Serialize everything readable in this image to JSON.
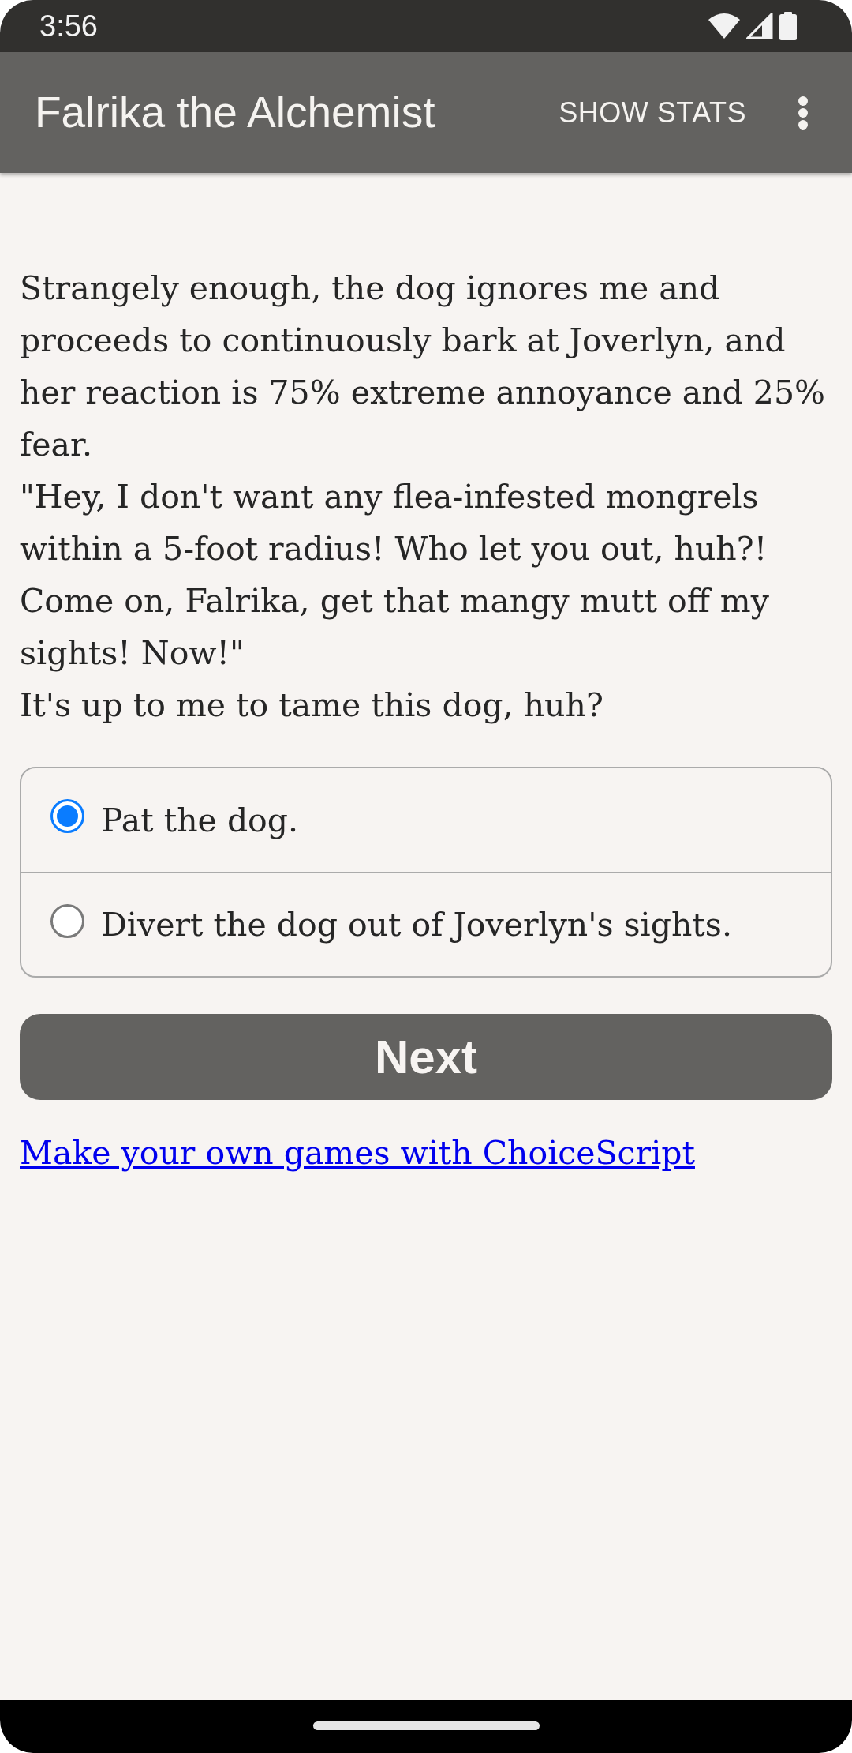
{
  "status_bar": {
    "time": "3:56"
  },
  "app_bar": {
    "title": "Falrika the Alchemist",
    "action": "SHOW STATS"
  },
  "story": {
    "paragraphs": [
      "Strangely enough, the dog ignores me and proceeds to continuously bark at Joverlyn, and her reaction is 75% extreme annoyance and 25% fear.",
      "\"Hey, I don't want any flea-infested mongrels within a 5-foot radius! Who let you out, huh?! Come on, Falrika, get that mangy mutt off my sights! Now!\"",
      "It's up to me to tame this dog, huh?"
    ]
  },
  "choices": [
    {
      "label": "Pat the dog.",
      "selected": true
    },
    {
      "label": "Divert the dog out of Joverlyn's sights.",
      "selected": false
    }
  ],
  "next_button": {
    "label": "Next"
  },
  "footer_link": {
    "label": "Make your own games with ChoiceScript"
  }
}
